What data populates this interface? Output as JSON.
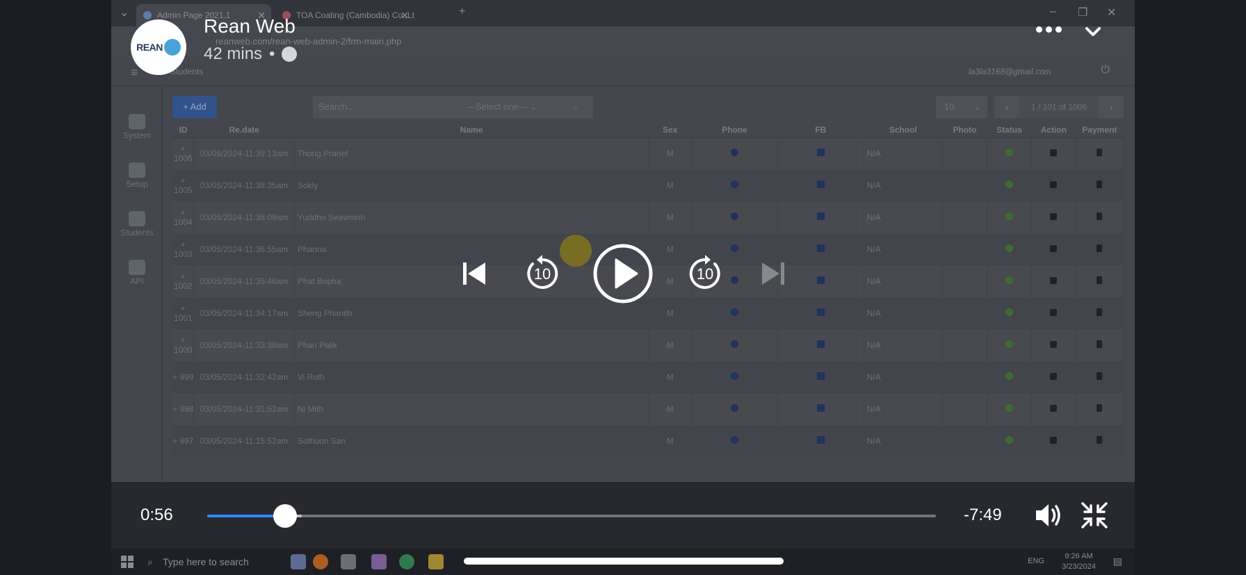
{
  "browser": {
    "tabs": [
      {
        "label": "Admin Page 2021.1",
        "active": true
      },
      {
        "label": "TOA Coating (Cambodia) Co.,Lt",
        "active": false
      }
    ],
    "url": "reanweb.com/rean-web-admin-2/frm-main.php"
  },
  "app": {
    "breadcrumb": "Students",
    "user_email": "la3la3168@gmail.com",
    "sidebar": [
      {
        "label": "System",
        "icon": "users-gear-icon"
      },
      {
        "label": "Setup",
        "icon": "plus-square-icon"
      },
      {
        "label": "Students",
        "icon": "school-icon"
      },
      {
        "label": "API",
        "icon": "plus-square-icon"
      }
    ],
    "toolbar": {
      "add_label": "+ Add",
      "search_placeholder": "Search...",
      "select_value": "---Select one---",
      "page_size": "10",
      "page_info": "1 / 101 of 1006"
    },
    "columns": [
      "ID",
      "Re.date",
      "Name",
      "Sex",
      "Phone",
      "FB",
      "School",
      "Photo",
      "Status",
      "Action",
      "Payment"
    ],
    "rows": [
      {
        "id": "+ 1006",
        "date": "03/05/2024-11:39:13am",
        "name": "Thong Pranet",
        "sex": "M",
        "school": "N/A"
      },
      {
        "id": "+ 1005",
        "date": "03/05/2024-11:38:35am",
        "name": "Sokly",
        "sex": "M",
        "school": "N/A"
      },
      {
        "id": "+ 1004",
        "date": "03/05/2024-11:38:09am",
        "name": "Yuddho Seavminh",
        "sex": "M",
        "school": "N/A"
      },
      {
        "id": "+ 1003",
        "date": "03/05/2024-11:36:55am",
        "name": "Phanna",
        "sex": "M",
        "school": "N/A"
      },
      {
        "id": "+ 1002",
        "date": "03/05/2024-11:35:46am",
        "name": "Phat Bopha",
        "sex": "M",
        "school": "N/A"
      },
      {
        "id": "+ 1001",
        "date": "03/05/2024-11:34:17am",
        "name": "Sheng Phanith",
        "sex": "M",
        "school": "N/A"
      },
      {
        "id": "+ 1000",
        "date": "03/05/2024-11:33:38am",
        "name": "Phan Palik",
        "sex": "M",
        "school": "N/A"
      },
      {
        "id": "+ 999",
        "date": "03/05/2024-11:32:42am",
        "name": "Vi Roth",
        "sex": "M",
        "school": "N/A"
      },
      {
        "id": "+ 998",
        "date": "03/05/2024-11:31:52am",
        "name": "Ni Mith",
        "sex": "M",
        "school": "N/A"
      },
      {
        "id": "+ 997",
        "date": "03/05/2024-11:15:52am",
        "name": "Sothuon San",
        "sex": "M",
        "school": "N/A"
      }
    ]
  },
  "taskbar": {
    "search_placeholder": "Type here to search",
    "language": "ENG",
    "time": "9:26 AM",
    "date": "3/23/2024"
  },
  "video": {
    "logo_text": "REAN",
    "page_name": "Rean Web",
    "posted_ago": "42 mins",
    "separator": "•",
    "current_time": "0:56",
    "remaining_time": "-7:49",
    "progress_fraction": 0.107,
    "buffered_fraction": 0.13,
    "skip_seconds": "10",
    "colors": {
      "progress": "#2d88ff",
      "overlay_text": "#ffffff"
    }
  }
}
